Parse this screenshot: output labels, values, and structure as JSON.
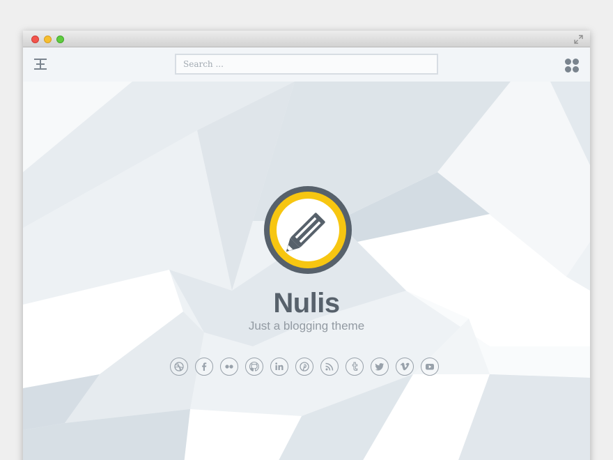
{
  "window": {
    "controls": [
      "close",
      "minimize",
      "zoom"
    ],
    "expand_icon": "expand-arrows-icon"
  },
  "header": {
    "menu_icon": "menu-icon",
    "search": {
      "placeholder": "Search ...",
      "value": ""
    },
    "grid_icon": "grid-icon"
  },
  "hero": {
    "logo_icon": "pencil-icon",
    "title": "Nulis",
    "tagline": "Just a blogging theme",
    "social": [
      {
        "name": "dribbble-icon"
      },
      {
        "name": "facebook-icon"
      },
      {
        "name": "flickr-icon"
      },
      {
        "name": "github-icon"
      },
      {
        "name": "linkedin-icon"
      },
      {
        "name": "pinterest-icon"
      },
      {
        "name": "rss-icon"
      },
      {
        "name": "tumblr-icon"
      },
      {
        "name": "twitter-icon"
      },
      {
        "name": "vimeo-icon"
      },
      {
        "name": "youtube-icon"
      }
    ]
  },
  "colors": {
    "accent": "#f7c611",
    "ring": "#57616b",
    "text": "#57616b",
    "muted": "#929aa2"
  }
}
